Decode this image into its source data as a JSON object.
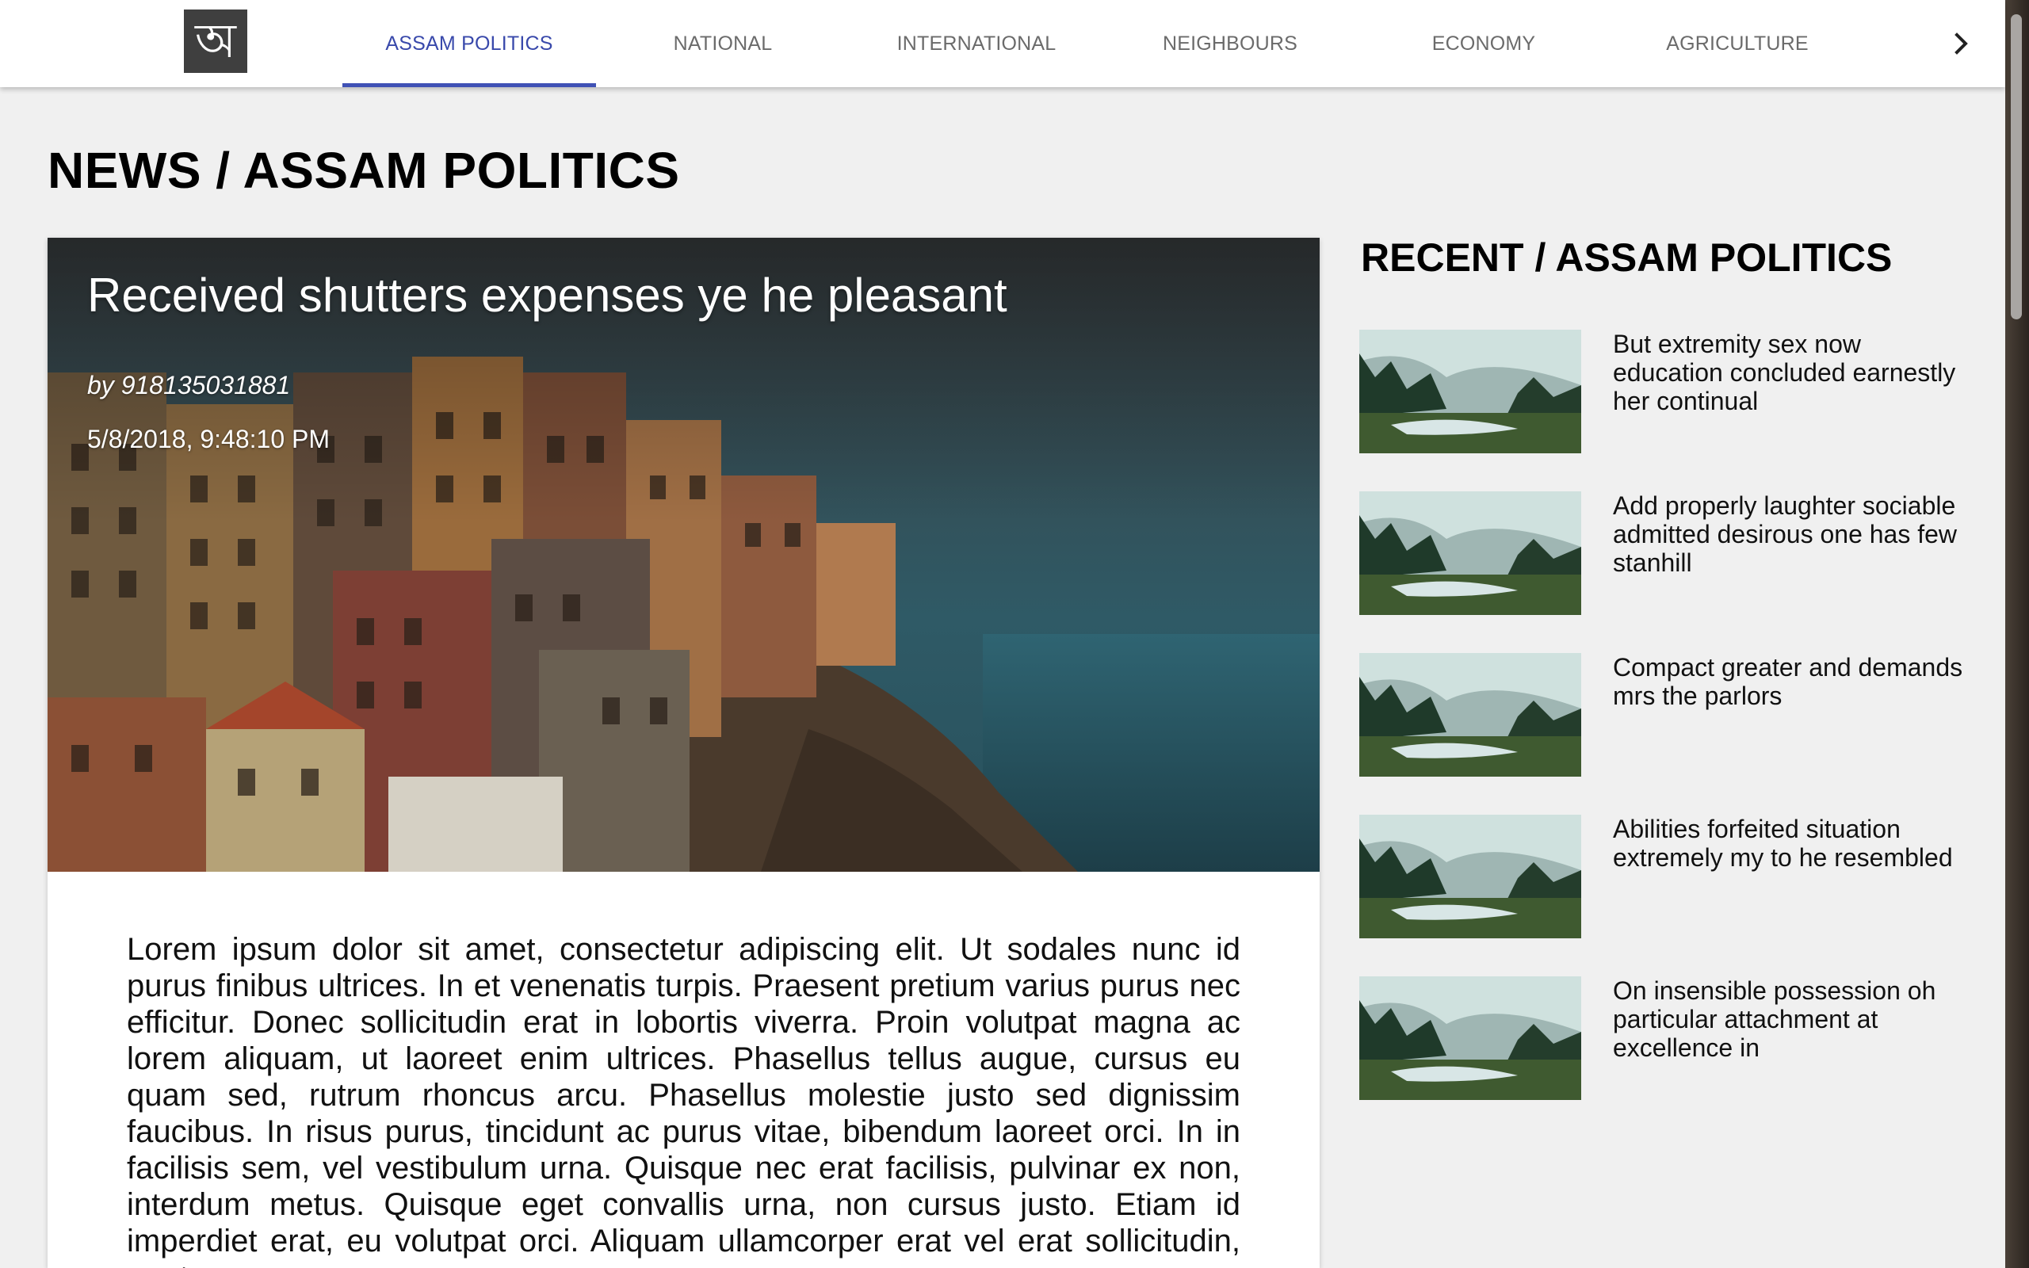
{
  "logo": {
    "glyph": "অ"
  },
  "nav": {
    "tabs": [
      {
        "label": "ASSAM POLITICS",
        "active": true
      },
      {
        "label": "NATIONAL"
      },
      {
        "label": "INTERNATIONAL"
      },
      {
        "label": "NEIGHBOURS"
      },
      {
        "label": "ECONOMY"
      },
      {
        "label": "AGRICULTURE"
      }
    ],
    "next_icon": "chevron-right-icon"
  },
  "page": {
    "title": "NEWS / ASSAM POLITICS"
  },
  "article": {
    "title": "Received shutters expenses ye he pleasant",
    "author": "by 918135031881",
    "date": "5/8/2018, 9:48:10 PM",
    "body": "Lorem ipsum dolor sit amet, consectetur adipiscing elit. Ut sodales nunc id purus finibus ultrices. In et venenatis turpis. Praesent pretium varius purus nec efficitur. Donec sollicitudin erat in lobortis viverra. Proin volutpat magna ac lorem aliquam, ut laoreet enim ultrices. Phasellus tellus augue, cursus eu quam sed, rutrum rhoncus arcu. Phasellus molestie justo sed dignissim faucibus. In risus purus, tincidunt ac purus vitae, bibendum laoreet orci. In in facilisis sem, vel vestibulum urna. Quisque nec erat facilisis, pulvinar ex non, interdum metus. Quisque eget convallis urna, non cursus justo. Etiam id imperdiet erat, eu volutpat orci.  Aliquam ullamcorper erat vel erat sollicitudin, eget cursus ex"
  },
  "recent": {
    "title": "RECENT / ASSAM POLITICS",
    "items": [
      {
        "title": "But extremity sex now education concluded earnestly her continual"
      },
      {
        "title": "Add properly laughter sociable admitted desirous one has few stanhill"
      },
      {
        "title": "Compact greater and demands mrs the parlors"
      },
      {
        "title": "Abilities forfeited situation extremely my to he resembled"
      },
      {
        "title": "On insensible possession oh particular attachment at excellence in"
      }
    ]
  },
  "colors": {
    "accent": "#3f51b5",
    "tab_inactive": "#6b6b6b",
    "page_bg": "#f0f0f0"
  }
}
